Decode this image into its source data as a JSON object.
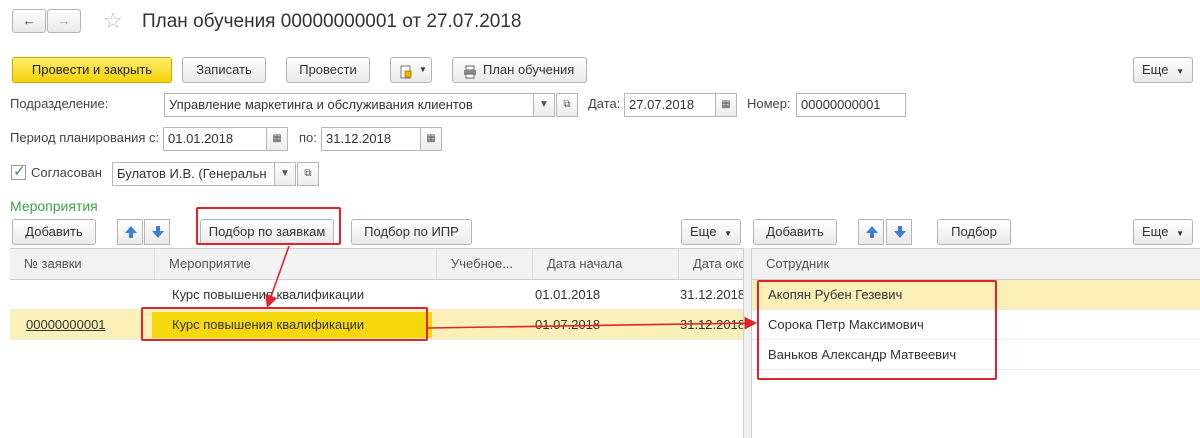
{
  "window": {
    "title": "План обучения 00000000001 от 27.07.2018"
  },
  "toolbar": {
    "post_close": "Провести и закрыть",
    "save": "Записать",
    "post": "Провести",
    "print_plan": "План обучения",
    "more": "Еще"
  },
  "form": {
    "department_label": "Подразделение:",
    "department_value": "Управление маркетинга и обслуживания клиентов",
    "date_label": "Дата:",
    "date_value": "27.07.2018",
    "number_label": "Номер:",
    "number_value": "00000000001",
    "period_label": "Период планирования с:",
    "period_from": "01.01.2018",
    "period_to_label": "по:",
    "period_to": "31.12.2018",
    "approved_label": "Согласован",
    "approved_checked": true,
    "approver_value": "Булатов И.В. (Генеральн"
  },
  "events": {
    "section_title": "Мероприятия",
    "add": "Добавить",
    "pick_by_requests": "Подбор по заявкам",
    "pick_by_ipr": "Подбор по ИПР",
    "more": "Еще",
    "columns": [
      "№ заявки",
      "Мероприятие",
      "Учебное...",
      "Дата начала",
      "Дата окон"
    ],
    "rows": [
      {
        "request": "",
        "event": "Курс повышения квалификации",
        "study": "",
        "start": "01.01.2018",
        "end": "31.12.2018"
      },
      {
        "request": "00000000001",
        "event": "Курс повышения квалификации",
        "study": "",
        "start": "01.07.2018",
        "end": "31.12.2018"
      }
    ]
  },
  "employees": {
    "add": "Добавить",
    "pick": "Подбор",
    "more": "Еще",
    "column": "Сотрудник",
    "rows": [
      "Акопян Рубен Гезевич",
      "Сорока Петр Максимович",
      "Ваньков Александр Матвеевич"
    ]
  },
  "colors": {
    "accent_green": "#3fa34d",
    "highlight_row": "#fbf1b8",
    "selected_cell": "#f7d80e",
    "annotation_red": "#e0242b"
  }
}
